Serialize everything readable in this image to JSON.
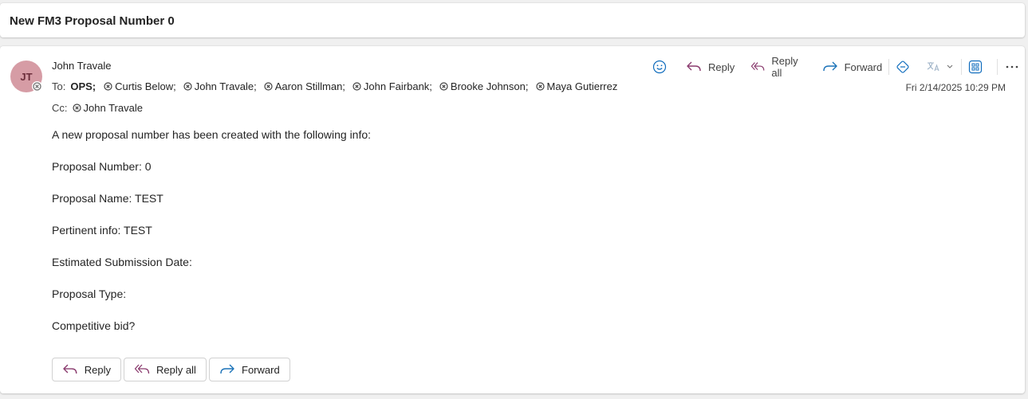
{
  "subject": "New FM3 Proposal Number 0",
  "message": {
    "avatar_initials": "JT",
    "sender": "John Travale",
    "to_label": "To:",
    "to_group": "OPS;",
    "to_recipients": [
      "Curtis Below;",
      "John Travale;",
      "Aaron Stillman;",
      "John Fairbank;",
      "Brooke Johnson;",
      "Maya Gutierrez"
    ],
    "cc_label": "Cc:",
    "cc_recipients": [
      "John Travale"
    ],
    "date": "Fri 2/14/2025 10:29 PM",
    "body": [
      "A new proposal number has been created with the following info:",
      "Proposal Number:  0",
      "Proposal Name:  TEST",
      "Pertinent info:  TEST",
      "Estimated Submission Date:",
      "Proposal Type:",
      "Competitive bid?"
    ]
  },
  "toolbar": {
    "reply_label": "Reply",
    "reply_all_label": "Reply all",
    "forward_label": "Forward"
  },
  "footer": {
    "reply_label": "Reply",
    "reply_all_label": "Reply all",
    "forward_label": "Forward"
  },
  "colors": {
    "reply_icon": "#8a3b6e",
    "reply_all_icon": "#8a3b6e",
    "forward_icon": "#1a72b8",
    "accent_blue": "#0f6cbd",
    "avatar_bg": "#d69ca5"
  }
}
